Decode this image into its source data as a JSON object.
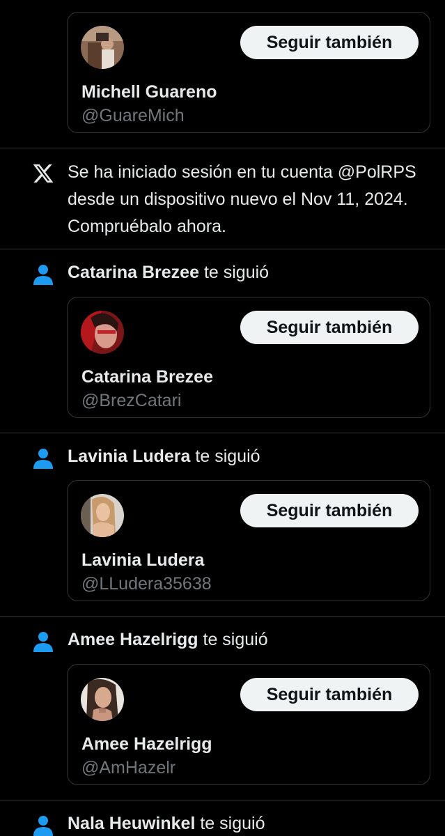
{
  "notifications": [
    {
      "type": "follow",
      "name": "",
      "action": "",
      "card": {
        "name": "Michell Guareno",
        "handle": "@GuareMich",
        "button_label": "Seguir también"
      }
    },
    {
      "type": "login",
      "text": "Se ha iniciado sesión en tu cuenta @PolRPS desde un dispositivo nuevo el Nov 11, 2024. Compruébalo ahora."
    },
    {
      "type": "follow",
      "name": "Catarina Brezee",
      "action": "te siguió",
      "card": {
        "name": "Catarina Brezee",
        "handle": "@BrezCatari",
        "button_label": "Seguir también"
      }
    },
    {
      "type": "follow",
      "name": "Lavinia Ludera",
      "action": "te siguió",
      "card": {
        "name": "Lavinia Ludera",
        "handle": "@LLudera35638",
        "button_label": "Seguir también"
      }
    },
    {
      "type": "follow",
      "name": "Amee Hazelrigg",
      "action": "te siguió",
      "card": {
        "name": "Amee Hazelrigg",
        "handle": "@AmHazelr",
        "button_label": "Seguir también"
      }
    },
    {
      "type": "follow",
      "name": "Nala Heuwinkel",
      "action": "te siguió"
    }
  ],
  "icons": {
    "follow": "person-icon",
    "login": "x-logo-icon"
  },
  "colors": {
    "background": "#000000",
    "accent": "#1d9bf0",
    "text": "#e7e9ea",
    "secondary_text": "#71767b",
    "button_bg": "#eff3f4",
    "button_text": "#0f1419",
    "border": "#2f3336"
  }
}
